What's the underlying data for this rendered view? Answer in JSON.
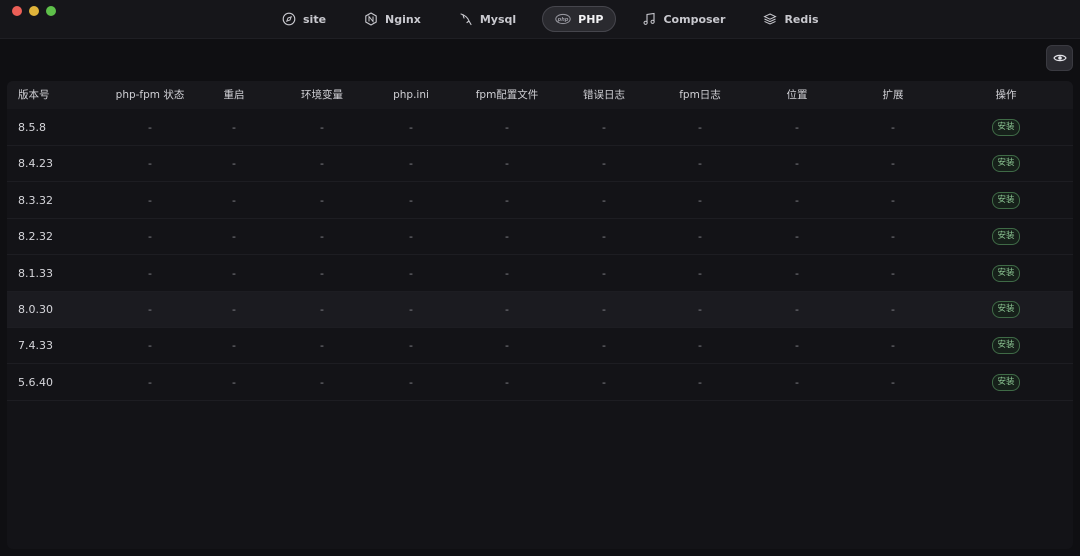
{
  "tabs": [
    {
      "label": "site",
      "icon": "compass-icon"
    },
    {
      "label": "Nginx",
      "icon": "nginx-icon"
    },
    {
      "label": "Mysql",
      "icon": "dolphin-icon"
    },
    {
      "label": "PHP",
      "icon": "php-icon",
      "active": true
    },
    {
      "label": "Composer",
      "icon": "music-note-icon"
    },
    {
      "label": "Redis",
      "icon": "layers-icon"
    }
  ],
  "table": {
    "headers": [
      "版本号",
      "php-fpm 状态",
      "重启",
      "环境变量",
      "php.ini",
      "fpm配置文件",
      "错误日志",
      "fpm日志",
      "位置",
      "扩展",
      "操作"
    ],
    "rows": [
      {
        "version": "8.5.8",
        "cells": [
          "-",
          "-",
          "-",
          "-",
          "-",
          "-",
          "-",
          "-",
          "-"
        ],
        "action": "安装"
      },
      {
        "version": "8.4.23",
        "cells": [
          "-",
          "-",
          "-",
          "-",
          "-",
          "-",
          "-",
          "-",
          "-"
        ],
        "action": "安装"
      },
      {
        "version": "8.3.32",
        "cells": [
          "-",
          "-",
          "-",
          "-",
          "-",
          "-",
          "-",
          "-",
          "-"
        ],
        "action": "安装"
      },
      {
        "version": "8.2.32",
        "cells": [
          "-",
          "-",
          "-",
          "-",
          "-",
          "-",
          "-",
          "-",
          "-"
        ],
        "action": "安装"
      },
      {
        "version": "8.1.33",
        "cells": [
          "-",
          "-",
          "-",
          "-",
          "-",
          "-",
          "-",
          "-",
          "-"
        ],
        "action": "安装"
      },
      {
        "version": "8.0.30",
        "cells": [
          "-",
          "-",
          "-",
          "-",
          "-",
          "-",
          "-",
          "-",
          "-"
        ],
        "action": "安装",
        "highlighted": true
      },
      {
        "version": "7.4.33",
        "cells": [
          "-",
          "-",
          "-",
          "-",
          "-",
          "-",
          "-",
          "-",
          "-"
        ],
        "action": "安装"
      },
      {
        "version": "5.6.40",
        "cells": [
          "-",
          "-",
          "-",
          "-",
          "-",
          "-",
          "-",
          "-",
          "-"
        ],
        "action": "安装"
      }
    ]
  },
  "colors": {
    "accent_green": "#8ec795",
    "background": "#0f0f12"
  }
}
